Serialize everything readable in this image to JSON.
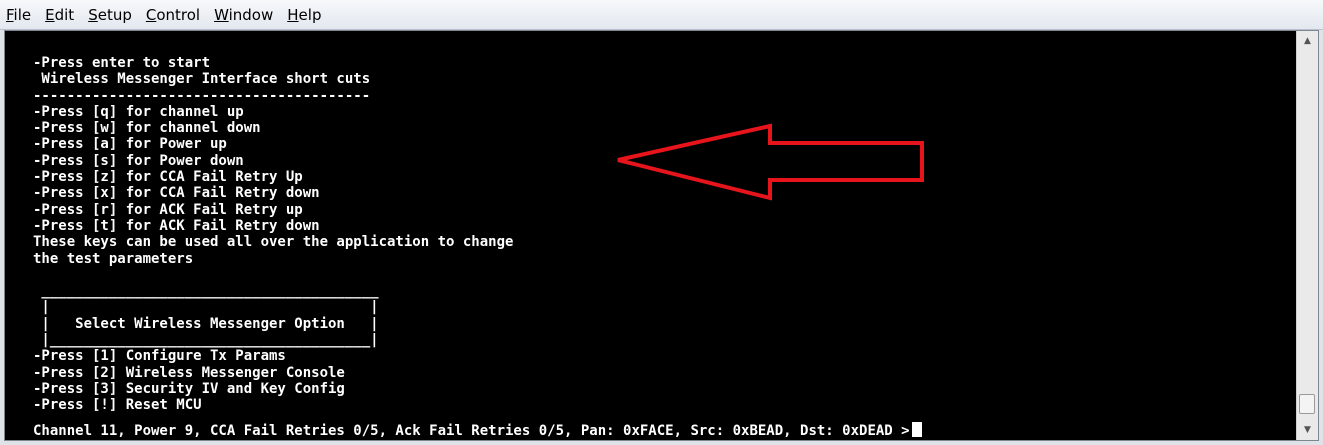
{
  "menu": {
    "items": [
      {
        "underline": "F",
        "rest": "ile"
      },
      {
        "underline": "E",
        "rest": "dit"
      },
      {
        "underline": "S",
        "rest": "etup"
      },
      {
        "underline": "C",
        "rest": "ontrol"
      },
      {
        "underline": "W",
        "rest": "indow"
      },
      {
        "underline": "H",
        "rest": "elp"
      }
    ]
  },
  "terminal": {
    "lines": [
      "-Press enter to start",
      " Wireless Messenger Interface short cuts",
      "----------------------------------------",
      "-Press [q] for channel up",
      "-Press [w] for channel down",
      "-Press [a] for Power up",
      "-Press [s] for Power down",
      "-Press [z] for CCA Fail Retry Up",
      "-Press [x] for CCA Fail Retry down",
      "-Press [r] for ACK Fail Retry up",
      "-Press [t] for ACK Fail Retry down",
      "These keys can be used all over the application to change",
      "the test parameters",
      "",
      " ________________________________________",
      " |                                      |",
      " |   Select Wireless Messenger Option   |",
      " |______________________________________|",
      "-Press [1] Configure Tx Params",
      "-Press [2] Wireless Messenger Console",
      "-Press [3] Security IV and Key Config",
      "-Press [!] Reset MCU"
    ],
    "status": "Channel 11, Power 9, CCA Fail Retries 0/5, Ack Fail Retries 0/5, Pan: 0xFACE, Src: 0xBEAD, Dst: 0xDEAD >"
  },
  "colors": {
    "terminal_bg": "#000000",
    "terminal_fg": "#ffffff",
    "annotation_arrow": "#e8141b"
  },
  "icons": {
    "scroll_up": "triangle-up",
    "scroll_down": "triangle-down",
    "annotation": "left-arrow-outline"
  }
}
